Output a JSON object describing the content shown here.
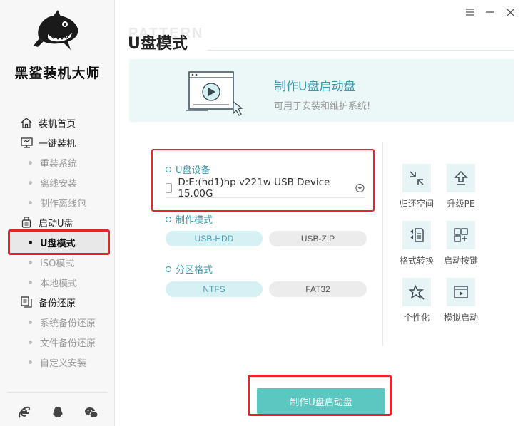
{
  "app": {
    "name": "黑鲨装机大师"
  },
  "sidebar": {
    "items": [
      {
        "label": "装机首页",
        "icon": "home-icon"
      },
      {
        "label": "一键装机",
        "icon": "monitor-icon"
      },
      {
        "label": "重装系统"
      },
      {
        "label": "离线安装"
      },
      {
        "label": "制作离线包"
      },
      {
        "label": "启动U盘",
        "icon": "usb-icon"
      },
      {
        "label": "U盘模式",
        "active": true
      },
      {
        "label": "ISO模式"
      },
      {
        "label": "本地模式"
      },
      {
        "label": "备份还原",
        "icon": "backup-icon"
      },
      {
        "label": "系统备份还原"
      },
      {
        "label": "文件备份还原"
      },
      {
        "label": "自定义安装"
      }
    ],
    "bottom_icons": [
      "ie-icon",
      "qq-icon",
      "wechat-icon"
    ]
  },
  "main": {
    "title": "U盘模式",
    "watermark": "PATTERN",
    "banner": {
      "title": "制作U盘启动盘",
      "subtitle": "可用于安装和维护系统!"
    },
    "device": {
      "label": "U盘设备",
      "value": "D:E:(hd1)hp v221w USB Device 15.00G"
    },
    "mode": {
      "label": "制作模式",
      "options": [
        "USB-HDD",
        "USB-ZIP"
      ],
      "selected": "USB-HDD"
    },
    "partition": {
      "label": "分区格式",
      "options": [
        "NTFS",
        "FAT32"
      ],
      "selected": "NTFS"
    },
    "tools": [
      {
        "label": "归还空间",
        "icon": "restore-space-icon"
      },
      {
        "label": "升级PE",
        "icon": "upgrade-icon"
      },
      {
        "label": "格式转换",
        "icon": "format-convert-icon"
      },
      {
        "label": "启动按键",
        "icon": "boot-key-icon"
      },
      {
        "label": "个性化",
        "icon": "personalize-icon"
      },
      {
        "label": "模拟启动",
        "icon": "simulate-boot-icon"
      }
    ],
    "make_button": "制作U盘启动盘"
  },
  "colors": {
    "accent": "#3a9ab0",
    "button": "#5cc6c0",
    "highlight": "#e4262b"
  }
}
